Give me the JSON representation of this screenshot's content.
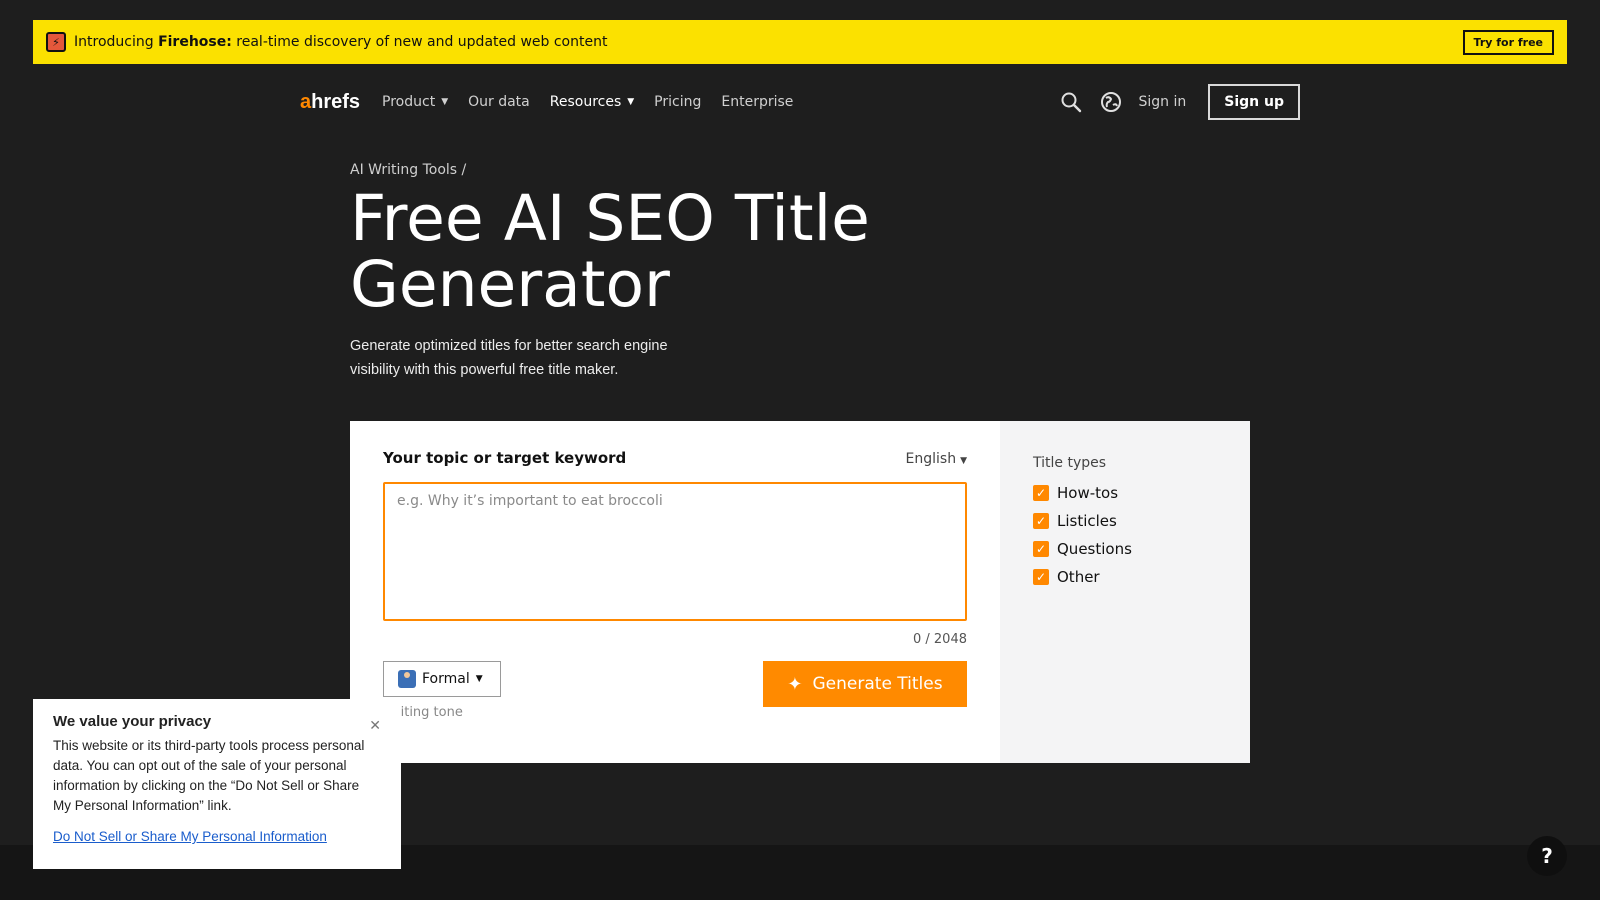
{
  "banner": {
    "intro": "Introducing ",
    "product": "Firehose:",
    "tagline": " real-time discovery of new and updated web content",
    "cta": "Try for free"
  },
  "nav": {
    "logo_a": "a",
    "logo_rest": "hrefs",
    "items": [
      {
        "label": "Product",
        "has_menu": true
      },
      {
        "label": "Our data",
        "has_menu": false
      },
      {
        "label": "Resources",
        "has_menu": true
      },
      {
        "label": "Pricing",
        "has_menu": false
      },
      {
        "label": "Enterprise",
        "has_menu": false
      }
    ],
    "sign_in": "Sign in",
    "sign_up": "Sign up"
  },
  "hero": {
    "breadcrumb": "AI Writing Tools /",
    "title": "Free AI SEO Title Generator",
    "subtitle": "Generate optimized titles for better search engine visibility with this powerful free title maker."
  },
  "tool": {
    "field_label": "Your topic or target keyword",
    "language": "English",
    "placeholder": "e.g. Why it’s important to eat broccoli",
    "value": "",
    "counter": "0 / 2048",
    "tone": "Formal",
    "tone_label": "Writing tone",
    "generate": "Generate Titles",
    "title_types_label": "Title types",
    "title_types": [
      "How-tos",
      "Listicles",
      "Questions",
      "Other"
    ]
  },
  "privacy": {
    "heading": "We value your privacy",
    "body": "This website or its third-party tools process personal data. You can opt out of the sale of your personal information by clicking on the “Do Not Sell or Share My Personal Information” link.",
    "link": "Do Not Sell or Share My Personal Information"
  },
  "help": "?",
  "colors": {
    "accent": "#ff8800",
    "banner": "#fbe100",
    "background": "#1e1e1e"
  }
}
